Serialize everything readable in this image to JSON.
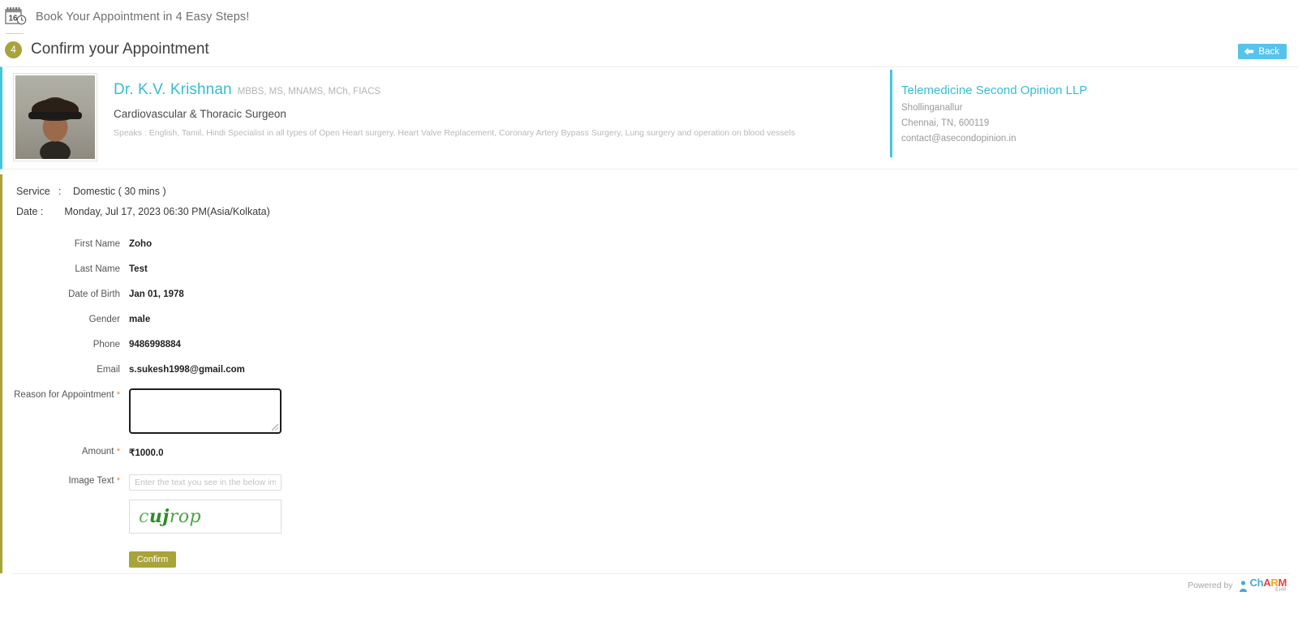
{
  "header": {
    "calendar_icon_day": "16",
    "title": "Book Your Appointment in 4 Easy Steps!"
  },
  "step": {
    "number": "4",
    "title": "Confirm your Appointment",
    "back_label": "Back"
  },
  "doctor": {
    "name": "Dr. K.V. Krishnan",
    "qualifications": "MBBS, MS, MNAMS, MCh, FIACS",
    "specialty": "Cardiovascular & Thoracic Surgeon",
    "description": "Speaks : English, Tamil, Hindi Specialist in all types of Open Heart surgery, Heart Valve Replacement, Coronary Artery Bypass Surgery, Lung surgery and operation on blood vessels"
  },
  "clinic": {
    "name": "Telemedicine Second Opinion LLP",
    "address_line1": "Shollinganallur",
    "address_line2": "Chennai, TN, 600119",
    "email": "contact@asecondopinion.in"
  },
  "appointment": {
    "service_label": "Service",
    "service_colon": ":",
    "service_value": "Domestic ( 30 mins )",
    "date_label": "Date :",
    "date_value": "Monday, Jul 17, 2023 06:30 PM(Asia/Kolkata)"
  },
  "form": {
    "first_name_label": "First Name",
    "first_name_value": "Zoho",
    "last_name_label": "Last Name",
    "last_name_value": "Test",
    "dob_label": "Date of Birth",
    "dob_value": "Jan 01, 1978",
    "gender_label": "Gender",
    "gender_value": "male",
    "phone_label": "Phone",
    "phone_value": "9486998884",
    "email_label": "Email",
    "email_value": "s.sukesh1998@gmail.com",
    "reason_label": "Reason for Appointment",
    "reason_value": "",
    "required_mark": "*",
    "amount_label": "Amount",
    "amount_value": "₹1000.0",
    "image_text_label": "Image Text",
    "image_text_value": "",
    "image_text_placeholder": "Enter the text you see in the below image",
    "captcha_part1": "c",
    "captcha_part2": "uj",
    "captcha_part3": "rop",
    "confirm_label": "Confirm"
  },
  "footer": {
    "powered_by": "Powered by",
    "brand_c": "Ch",
    "brand_a": "A",
    "brand_r": "R",
    "brand_m": "M",
    "brand_sub": "EHR"
  },
  "colors": {
    "accent_cyan": "#45c4e0",
    "accent_olive": "#a8a33a",
    "back_blue": "#55c3ea",
    "required_orange": "#f0852a",
    "captcha_green": "#3f9b32"
  }
}
